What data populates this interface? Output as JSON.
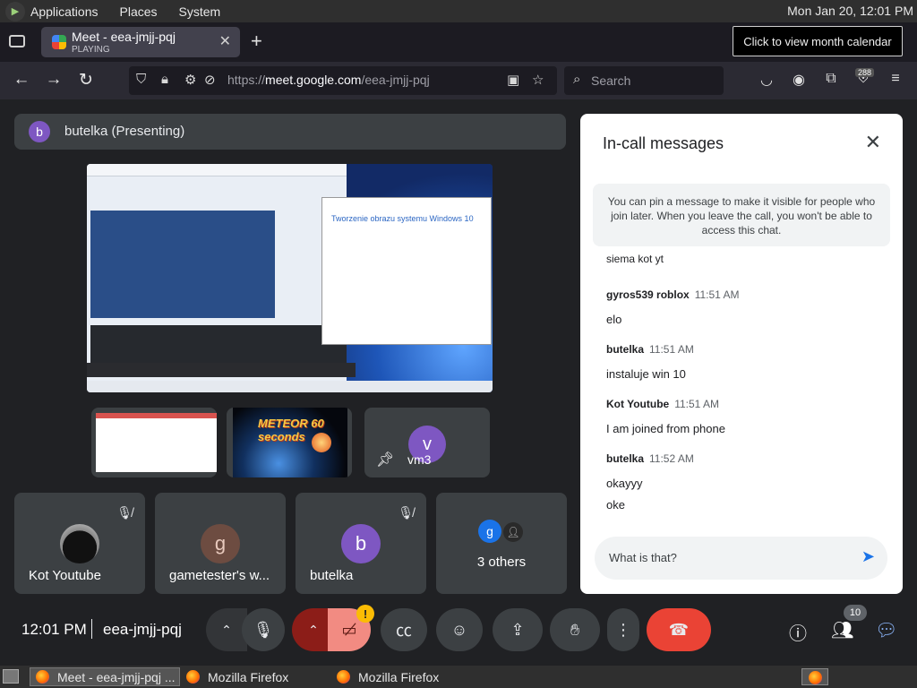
{
  "gnome_panel": {
    "menus": [
      "Applications",
      "Places",
      "System"
    ],
    "clock": "Mon Jan 20, 12:01 PM",
    "tooltip": "Click to view month calendar"
  },
  "browser": {
    "tab": {
      "title": "Meet - eea-jmjj-pqj",
      "status": "PLAYING"
    },
    "url": {
      "prefix": "https://",
      "domain": "meet.google.com",
      "path": "/eea-jmjj-pqj"
    },
    "search_placeholder": "Search",
    "extension_badge": "288"
  },
  "meet": {
    "presenting_avatar": "b",
    "presenting_label": "butelka (Presenting)",
    "screen_share_dialog_title": "Tworzenie obrazu systemu Windows 10",
    "screen_share_logo": "METEOR 60 seconds",
    "tiles_small": [
      {
        "avatar": "v",
        "name": "vm3"
      }
    ],
    "tiles_big": [
      {
        "name": "Kot Youtube"
      },
      {
        "avatar": "g",
        "name": "gametester's w..."
      },
      {
        "avatar": "b",
        "name": "butelka"
      },
      {
        "avatar": "g",
        "name": "3 others"
      }
    ]
  },
  "chat": {
    "title": "In-call messages",
    "notice": "You can pin a message to make it visible for people who join later. When you leave the call, you won't be able to access this chat.",
    "partial_message": "siema kot yt",
    "messages": [
      {
        "sender": "gyros539 roblox",
        "time": "11:51 AM",
        "lines": [
          "elo"
        ]
      },
      {
        "sender": "butelka",
        "time": "11:51 AM",
        "lines": [
          "instaluje win 10"
        ]
      },
      {
        "sender": "Kot Youtube",
        "time": "11:51 AM",
        "lines": [
          "I am joined from phone"
        ]
      },
      {
        "sender": "butelka",
        "time": "11:52 AM",
        "lines": [
          "okayyy",
          "oke"
        ]
      }
    ],
    "input_value": "What is that?"
  },
  "controls": {
    "time": "12:01 PM",
    "meeting_code": "eea-jmjj-pqj",
    "warning_badge": "!",
    "people_count": "10"
  },
  "taskbar": {
    "items": [
      "Meet - eea-jmjj-pqj ...",
      "Mozilla Firefox",
      "Mozilla Firefox"
    ]
  }
}
